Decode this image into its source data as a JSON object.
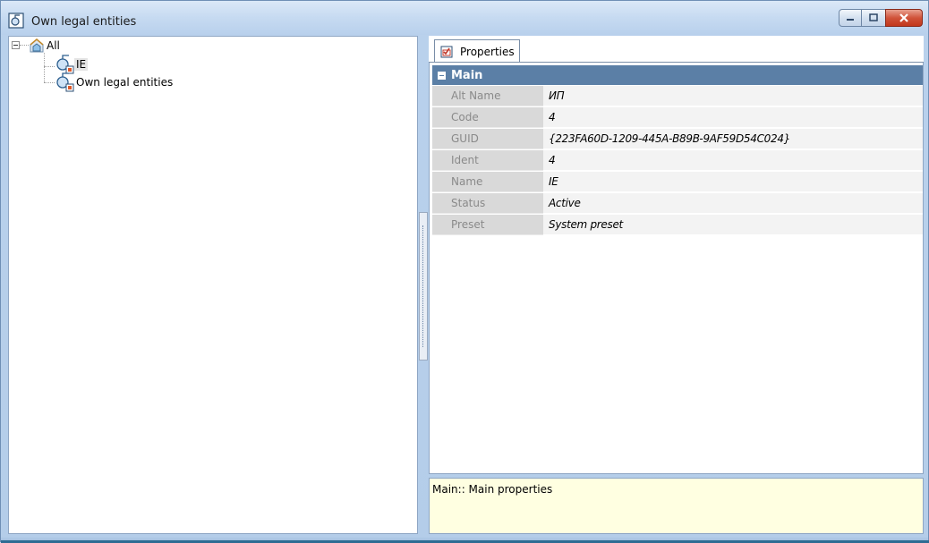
{
  "window": {
    "title": "Own legal entities",
    "icon": "legal-entity-icon",
    "buttons": [
      "minimize-icon",
      "maximize-icon",
      "close-icon"
    ]
  },
  "tree": {
    "root": {
      "label": "All",
      "icon": "house-cube-icon",
      "expanded": true
    },
    "children": [
      {
        "label": "IE",
        "icon": "entity-node-icon",
        "selected": true
      },
      {
        "label": "Own legal entities",
        "icon": "entity-node-icon",
        "selected": false
      }
    ]
  },
  "properties": {
    "tab_label": "Properties",
    "tab_icon": "properties-check-icon",
    "category": "Main",
    "rows": [
      {
        "name": "Alt Name",
        "value": "ИП"
      },
      {
        "name": "Code",
        "value": "4"
      },
      {
        "name": "GUID",
        "value": "{223FA60D-1209-445A-B89B-9AF59D54C024}"
      },
      {
        "name": "Ident",
        "value": "4"
      },
      {
        "name": "Name",
        "value": "IE"
      },
      {
        "name": "Status",
        "value": "Active"
      },
      {
        "name": "Preset",
        "value": "System preset"
      }
    ]
  },
  "description": "Main:: Main properties",
  "colors": {
    "category_header": "#5b7fa6",
    "description_bg": "#ffffe1",
    "frame": "#c9dcef"
  }
}
